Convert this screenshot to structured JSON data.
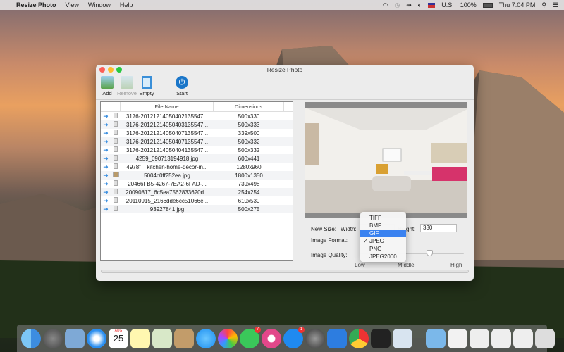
{
  "menubar": {
    "app": "Resize Photo",
    "items": [
      "View",
      "Window",
      "Help"
    ],
    "input_source": "U.S.",
    "battery": "100%",
    "clock": "Thu 7:04 PM"
  },
  "window": {
    "title": "Resize Photo"
  },
  "toolbar": {
    "add": "Add",
    "remove": "Remove",
    "empty": "Empty",
    "start": "Start"
  },
  "table": {
    "headers": {
      "file_name": "File Name",
      "dimensions": "Dimensions"
    },
    "rows": [
      {
        "name": "3176-20121214050402135547...",
        "dim": "500x330"
      },
      {
        "name": "3176-20121214050403135547...",
        "dim": "500x333"
      },
      {
        "name": "3176-20121214050407135547...",
        "dim": "339x500"
      },
      {
        "name": "3176-20121214050407135547...",
        "dim": "500x332"
      },
      {
        "name": "3176-20121214050404135547...",
        "dim": "500x332"
      },
      {
        "name": "4259_090713194918.jpg",
        "dim": "600x441"
      },
      {
        "name": "4978f__kitchen-home-decor-in...",
        "dim": "1280x960"
      },
      {
        "name": "5004c0ff252ea.jpg",
        "dim": "1800x1350"
      },
      {
        "name": "20466FB5-4267-7EA2-6FAD-...",
        "dim": "739x498"
      },
      {
        "name": "20090817_6c5ea7562833620d...",
        "dim": "254x254"
      },
      {
        "name": "20110915_2166dde6cc51066e...",
        "dim": "610x530"
      },
      {
        "name": "93927841.jpg",
        "dim": "500x275"
      }
    ]
  },
  "settings": {
    "new_size": "New Size:",
    "width_label": "Width:",
    "height_label": "Height:",
    "height_value": "330",
    "format_label": "Image Format:",
    "quality_label": "Image Quality:",
    "quality_low": "Low",
    "quality_middle": "Middle",
    "quality_high": "High",
    "quality_value": 0.68
  },
  "format_menu": {
    "options": [
      "TIFF",
      "BMP",
      "GIF",
      "JPEG",
      "PNG",
      "JPEG2000"
    ],
    "highlighted": "GIF",
    "checked": "JPEG",
    "check_mark": "✓"
  },
  "dock": {
    "calendar_month": "AUG",
    "calendar_day": "25",
    "facetime_badge": "7",
    "appstore_badge": "1"
  }
}
